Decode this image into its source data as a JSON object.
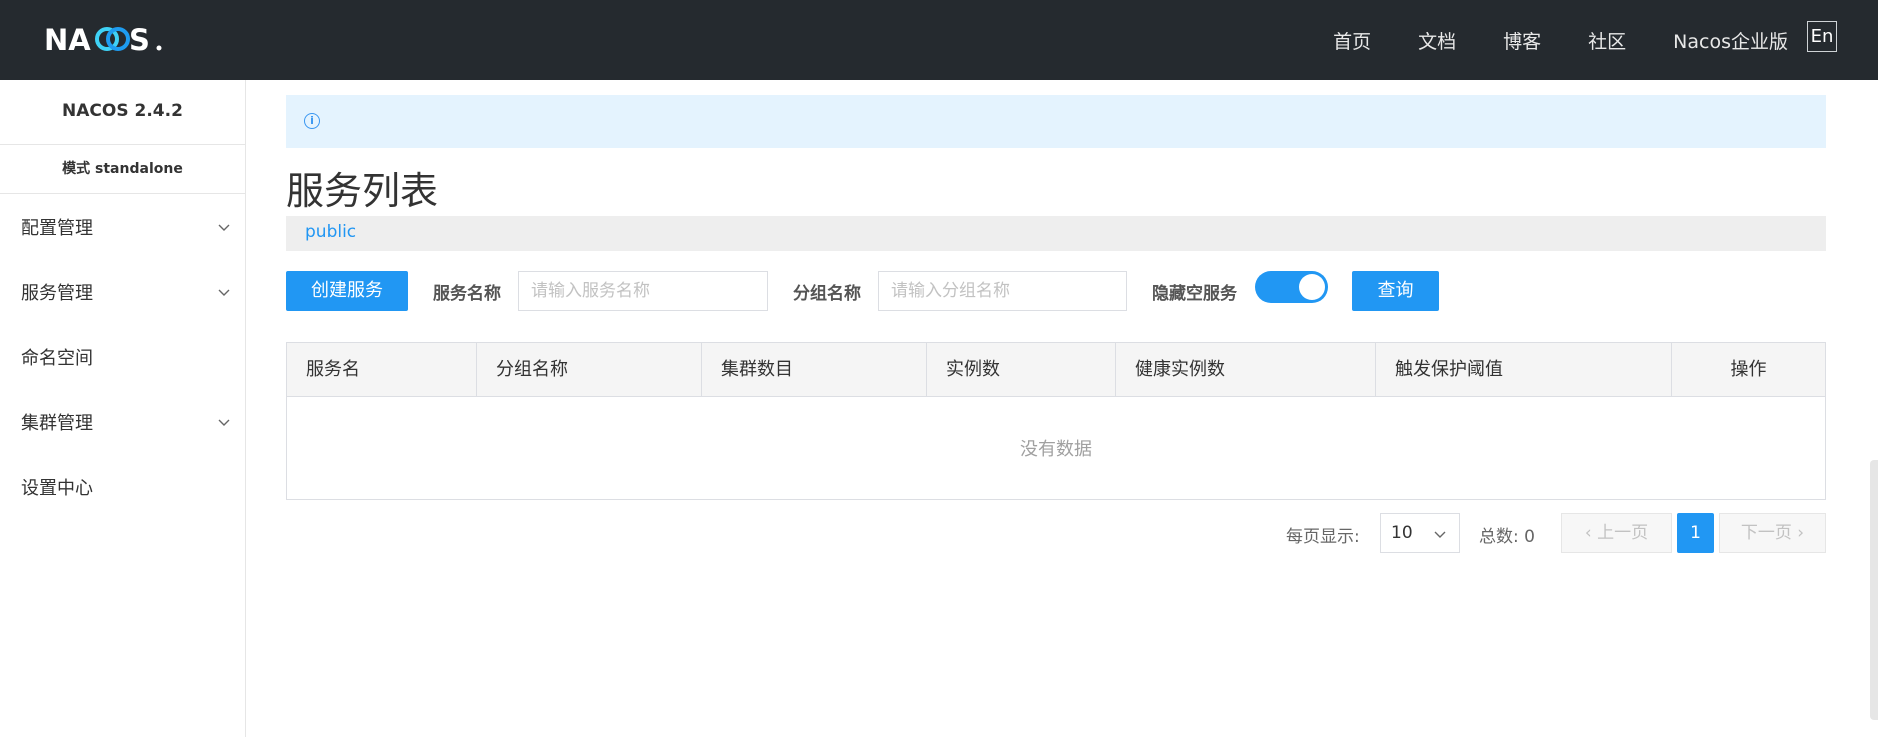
{
  "header": {
    "logo_text": "NACOS.",
    "nav": [
      "首页",
      "文档",
      "博客",
      "社区",
      "Nacos企业版"
    ],
    "lang_button": "En"
  },
  "sidebar": {
    "version": "NACOS 2.4.2",
    "mode": "模式 standalone",
    "items": [
      {
        "label": "配置管理",
        "expandable": true
      },
      {
        "label": "服务管理",
        "expandable": true
      },
      {
        "label": "命名空间",
        "expandable": false
      },
      {
        "label": "集群管理",
        "expandable": true
      },
      {
        "label": "设置中心",
        "expandable": false
      }
    ]
  },
  "main": {
    "notice_icon": "info-icon",
    "title": "服务列表",
    "namespace": "public",
    "toolbar": {
      "create_button": "创建服务",
      "service_name_label": "服务名称",
      "service_name_placeholder": "请输入服务名称",
      "group_name_label": "分组名称",
      "group_name_placeholder": "请输入分组名称",
      "hide_empty_label": "隐藏空服务",
      "hide_empty_on": true,
      "query_button": "查询"
    },
    "table": {
      "columns": [
        "服务名",
        "分组名称",
        "集群数目",
        "实例数",
        "健康实例数",
        "触发保护阈值",
        "操作"
      ],
      "rows": [],
      "empty_text": "没有数据"
    },
    "pagination": {
      "page_size_label": "每页显示:",
      "page_size": "10",
      "total_label": "总数: 0",
      "prev": "上一页",
      "current_page": "1",
      "next": "下一页"
    }
  },
  "colors": {
    "topbar": "#252a2f",
    "primary": "#2197f3",
    "notice_bg": "#e4f3fe"
  }
}
